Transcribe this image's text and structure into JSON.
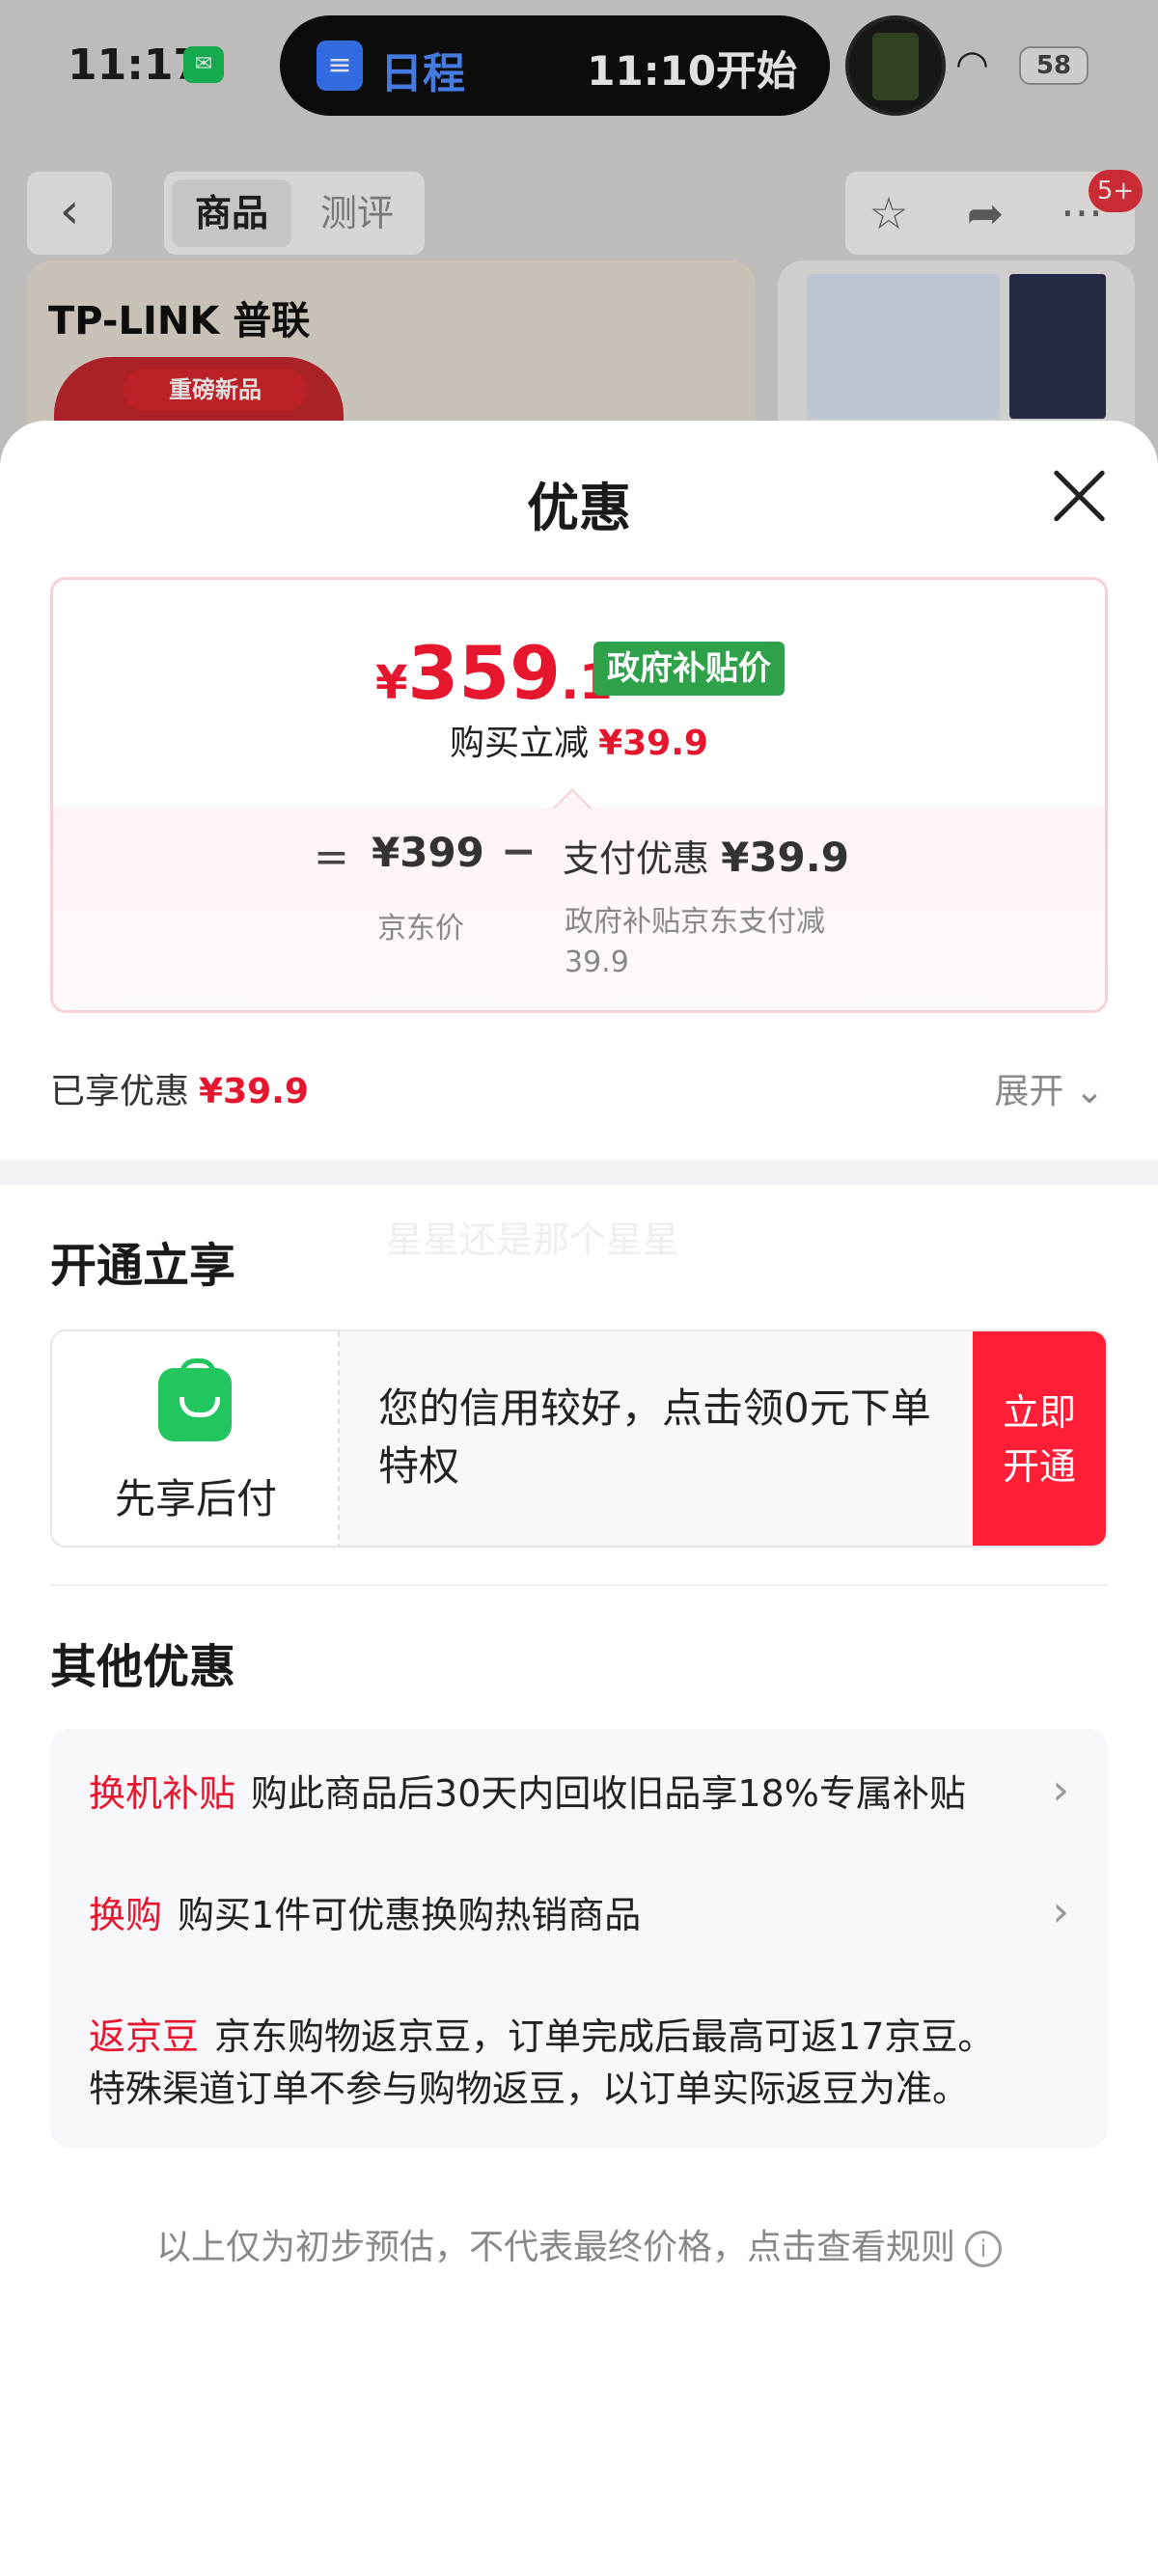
{
  "status_bar": {
    "time": "11:17",
    "island_title": "日程",
    "island_time": "11:10开始",
    "battery": "58"
  },
  "nav": {
    "tab_goods": "商品",
    "tab_review": "测评",
    "badge": "5+"
  },
  "product": {
    "brand": "TP-LINK 普联",
    "tag": "重磅新品"
  },
  "sheet": {
    "title": "优惠",
    "price_card": {
      "currency": "¥",
      "final_int": "359",
      "final_dec": ".1",
      "tag": "政府补贴价",
      "buy_label": "购买立减",
      "buy_amount": "¥39.9",
      "equals": "=",
      "jd_price": "¥399",
      "jd_label": "京东价",
      "minus": "−",
      "pay_label": "支付优惠",
      "pay_amount": "¥39.9",
      "pay_desc": "政府补贴京东支付减39.9"
    },
    "enjoyed_label": "已享优惠",
    "enjoyed_amount": "¥39.9",
    "expand_label": "展开",
    "open_section": {
      "title": "开通立享",
      "watermark": "星星还是那个星星",
      "name": "先享后付",
      "desc": "您的信用较好，点击领0元下单特权",
      "button_line1": "立即",
      "button_line2": "开通"
    },
    "other_section": {
      "title": "其他优惠",
      "offers": [
        {
          "tag": "换机补贴",
          "text": "购此商品后30天内回收旧品享18%专属补贴"
        },
        {
          "tag": "换购",
          "text": "购买1件可优惠换购热销商品"
        },
        {
          "tag": "返京豆",
          "text": "京东购物返京豆，订单完成后最高可返17京豆。",
          "text2": "特殊渠道订单不参与购物返豆，以订单实际返豆为准。"
        }
      ]
    },
    "footnote": "以上仅为初步预估，不代表最终价格，点击查看规则"
  },
  "colors": {
    "price_red": "#e5162d",
    "gov_green": "#2fa14a",
    "open_button_red": "#ff1e35",
    "bag_green": "#22c55e"
  }
}
